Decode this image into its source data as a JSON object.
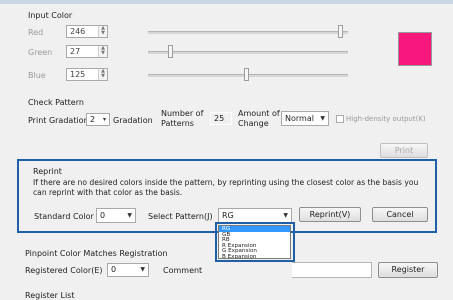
{
  "input_color": {
    "title": "Input Color",
    "red": {
      "label": "Red",
      "value": "246",
      "slider_fraction": 0.96
    },
    "green": {
      "label": "Green",
      "value": "27",
      "slider_fraction": 0.11
    },
    "blue": {
      "label": "Blue",
      "value": "125",
      "slider_fraction": 0.49
    },
    "swatch_color": "#f6187d"
  },
  "check_pattern": {
    "title": "Check Pattern",
    "print_gradation_label": "Print Gradation",
    "gradation_value": "2",
    "gradation_unit": "Gradation",
    "number_of_patterns_label": "Number of Patterns",
    "number_of_patterns_value": "25",
    "amount_of_change_label": "Amount of Change",
    "amount_of_change_value": "Normal",
    "high_density_label": "High-density output(K)",
    "print_button": "Print"
  },
  "reprint": {
    "title": "Reprint",
    "description": "If there are no desired colors inside the pattern, by reprinting using the closest color as the basis you can reprint with that color as the basis.",
    "standard_color_label": "Standard Color",
    "standard_color_value": "0",
    "select_pattern_label": "Select Pattern(J)",
    "select_pattern_value": "RG",
    "reprint_button": "Reprint(V)",
    "cancel_button": "Cancel",
    "dropdown_options": [
      "RG",
      "GB",
      "RB",
      "R Expansion",
      "G Expansion",
      "B Expansion"
    ],
    "selected_index": 0
  },
  "pinpoint": {
    "title": "Pinpoint Color Matches Registration",
    "registered_color_label": "Registered Color(E)",
    "registered_color_value": "0",
    "comment_label": "Comment",
    "register_button": "Register"
  },
  "register_list": {
    "title": "Register List"
  },
  "colors": {
    "highlight_frame": "#1f5fa8",
    "selection": "#3399ff"
  }
}
